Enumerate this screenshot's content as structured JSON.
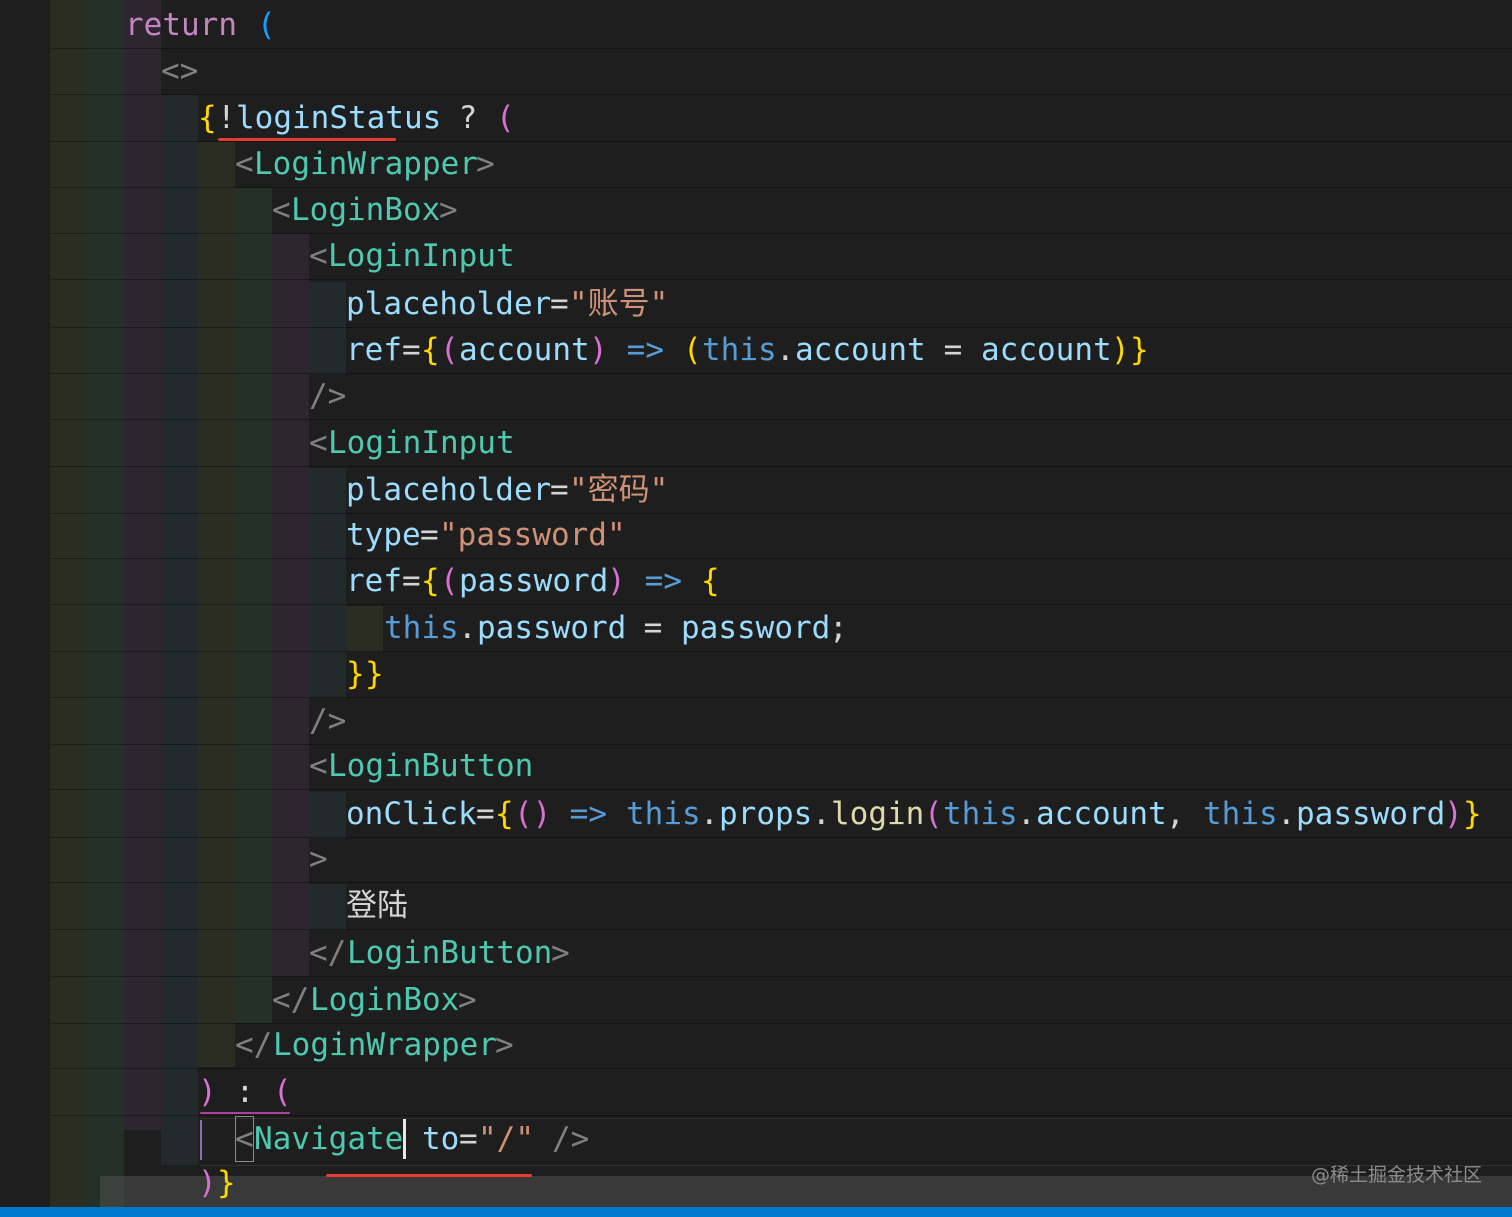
{
  "editor": {
    "watermark": "@稀土掘金技术社区",
    "colors": {
      "background": "#1e1e1e",
      "keyword": "#c586c0",
      "tag": "#4ec9b0",
      "attribute": "#9cdcfe",
      "string": "#ce9178",
      "this": "#569cd6",
      "function": "#dcdcaa",
      "bracket_gold": "#ffd700",
      "bracket_pink": "#da70d6",
      "bracket_blue": "#179fff",
      "annotation_red": "#e63b2e",
      "statusbar": "#007acc"
    },
    "lines": {
      "l1": {
        "kw": "return",
        "p": "("
      },
      "l2": {
        "frag": "<>"
      },
      "l3": {
        "b1": "{",
        "bang": "!",
        "var": "loginStatus",
        "q": " ? ",
        "p": "("
      },
      "l4": {
        "lt": "<",
        "tag": "LoginWrapper",
        "gt": ">"
      },
      "l5": {
        "lt": "<",
        "tag": "LoginBox",
        "gt": ">"
      },
      "l6": {
        "lt": "<",
        "tag": "LoginInput"
      },
      "l7": {
        "attr": "placeholder",
        "eq": "=",
        "str": "\"账号\""
      },
      "l8": {
        "attr": "ref",
        "eq": "=",
        "b1": "{",
        "p1": "(",
        "arg": "account",
        "p2": ")",
        "arrow": " => ",
        "p3": "(",
        "this": "this",
        "dot": ".",
        "prop": "account",
        "assign": " = ",
        "val": "account",
        "p4": ")",
        "b2": "}"
      },
      "l9": {
        "close": "/>"
      },
      "l10": {
        "lt": "<",
        "tag": "LoginInput"
      },
      "l11": {
        "attr": "placeholder",
        "eq": "=",
        "str": "\"密码\""
      },
      "l12": {
        "attr": "type",
        "eq": "=",
        "str": "\"password\""
      },
      "l13": {
        "attr": "ref",
        "eq": "=",
        "b1": "{",
        "p1": "(",
        "arg": "password",
        "p2": ")",
        "arrow": " => ",
        "b2": "{"
      },
      "l14": {
        "this": "this",
        "dot": ".",
        "prop": "password",
        "assign": " = ",
        "val": "password",
        "semi": ";"
      },
      "l15": {
        "b1": "}",
        "b2": "}"
      },
      "l16": {
        "close": "/>"
      },
      "l17": {
        "lt": "<",
        "tag": "LoginButton"
      },
      "l18": {
        "attr": "onClick",
        "eq": "=",
        "b1": "{",
        "p1": "()",
        "arrow": " => ",
        "this1": "this",
        "d1": ".",
        "props": "props",
        "d2": ".",
        "fn": "login",
        "p2": "(",
        "this2": "this",
        "d3": ".",
        "acc": "account",
        "comma": ", ",
        "this3": "this",
        "d4": ".",
        "pwd": "password",
        "p3": ")",
        "b2": "}"
      },
      "l19": {
        "gt": ">"
      },
      "l20": {
        "text": "登陆"
      },
      "l21": {
        "lt": "</",
        "tag": "LoginButton",
        "gt": ">"
      },
      "l22": {
        "lt": "</",
        "tag": "LoginBox",
        "gt": ">"
      },
      "l23": {
        "lt": "</",
        "tag": "LoginWrapper",
        "gt": ">"
      },
      "l24": {
        "p1": ")",
        "colon": " : ",
        "p2": "("
      },
      "l25": {
        "lt": "<",
        "tag": "Navigate",
        "attr": "to",
        "eq": "=",
        "str": "\"/\"",
        "close": "/>"
      },
      "l26": {
        "p": ")",
        "b": "}"
      }
    }
  }
}
